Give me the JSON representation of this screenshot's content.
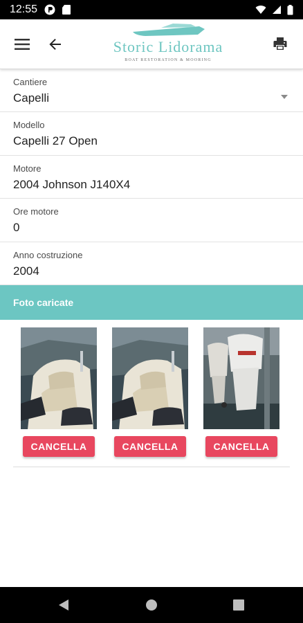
{
  "status_bar": {
    "time": "12:55"
  },
  "header": {
    "logo_title": "Storic Lidorama",
    "logo_subtitle": "BOAT RESTORATION & MOORING",
    "brand_color": "#6ec6c1"
  },
  "form": {
    "fields": [
      {
        "label": "Cantiere",
        "value": "Capelli"
      },
      {
        "label": "Modello",
        "value": "Capelli 27 Open"
      },
      {
        "label": "Motore",
        "value": "2004 Johnson J140X4"
      },
      {
        "label": "Ore motore",
        "value": "0"
      },
      {
        "label": "Anno costruzione",
        "value": "2004"
      }
    ]
  },
  "photos": {
    "header": "Foto caricate",
    "header_color": "#6cc6c2",
    "delete_label": "CANCELLA",
    "delete_color": "#e8475f",
    "items": [
      {
        "subject": "boat-cockpit"
      },
      {
        "subject": "boat-cockpit"
      },
      {
        "subject": "outboard-engine"
      }
    ]
  }
}
